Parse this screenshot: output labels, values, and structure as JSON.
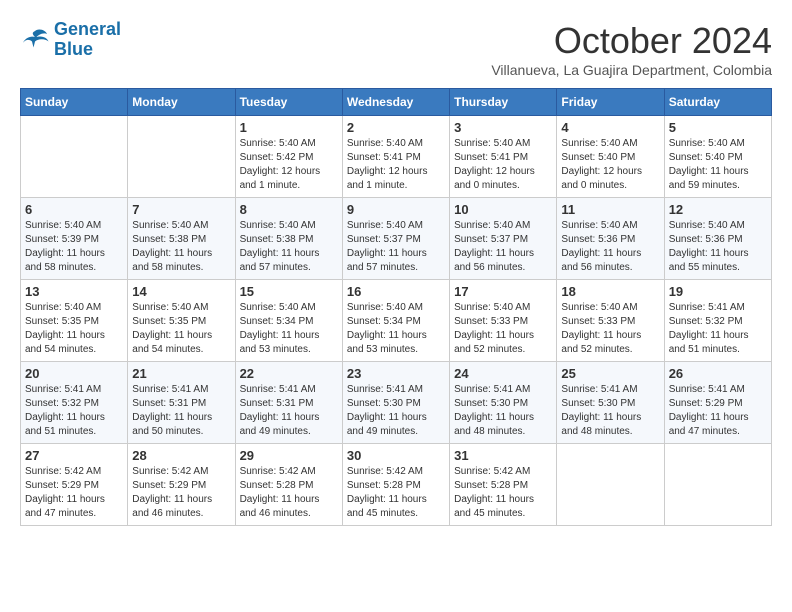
{
  "header": {
    "logo_line1": "General",
    "logo_line2": "Blue",
    "month_title": "October 2024",
    "location": "Villanueva, La Guajira Department, Colombia"
  },
  "days_of_week": [
    "Sunday",
    "Monday",
    "Tuesday",
    "Wednesday",
    "Thursday",
    "Friday",
    "Saturday"
  ],
  "weeks": [
    [
      {
        "day": "",
        "info": ""
      },
      {
        "day": "",
        "info": ""
      },
      {
        "day": "1",
        "info": "Sunrise: 5:40 AM\nSunset: 5:42 PM\nDaylight: 12 hours and 1 minute."
      },
      {
        "day": "2",
        "info": "Sunrise: 5:40 AM\nSunset: 5:41 PM\nDaylight: 12 hours and 1 minute."
      },
      {
        "day": "3",
        "info": "Sunrise: 5:40 AM\nSunset: 5:41 PM\nDaylight: 12 hours and 0 minutes."
      },
      {
        "day": "4",
        "info": "Sunrise: 5:40 AM\nSunset: 5:40 PM\nDaylight: 12 hours and 0 minutes."
      },
      {
        "day": "5",
        "info": "Sunrise: 5:40 AM\nSunset: 5:40 PM\nDaylight: 11 hours and 59 minutes."
      }
    ],
    [
      {
        "day": "6",
        "info": "Sunrise: 5:40 AM\nSunset: 5:39 PM\nDaylight: 11 hours and 58 minutes."
      },
      {
        "day": "7",
        "info": "Sunrise: 5:40 AM\nSunset: 5:38 PM\nDaylight: 11 hours and 58 minutes."
      },
      {
        "day": "8",
        "info": "Sunrise: 5:40 AM\nSunset: 5:38 PM\nDaylight: 11 hours and 57 minutes."
      },
      {
        "day": "9",
        "info": "Sunrise: 5:40 AM\nSunset: 5:37 PM\nDaylight: 11 hours and 57 minutes."
      },
      {
        "day": "10",
        "info": "Sunrise: 5:40 AM\nSunset: 5:37 PM\nDaylight: 11 hours and 56 minutes."
      },
      {
        "day": "11",
        "info": "Sunrise: 5:40 AM\nSunset: 5:36 PM\nDaylight: 11 hours and 56 minutes."
      },
      {
        "day": "12",
        "info": "Sunrise: 5:40 AM\nSunset: 5:36 PM\nDaylight: 11 hours and 55 minutes."
      }
    ],
    [
      {
        "day": "13",
        "info": "Sunrise: 5:40 AM\nSunset: 5:35 PM\nDaylight: 11 hours and 54 minutes."
      },
      {
        "day": "14",
        "info": "Sunrise: 5:40 AM\nSunset: 5:35 PM\nDaylight: 11 hours and 54 minutes."
      },
      {
        "day": "15",
        "info": "Sunrise: 5:40 AM\nSunset: 5:34 PM\nDaylight: 11 hours and 53 minutes."
      },
      {
        "day": "16",
        "info": "Sunrise: 5:40 AM\nSunset: 5:34 PM\nDaylight: 11 hours and 53 minutes."
      },
      {
        "day": "17",
        "info": "Sunrise: 5:40 AM\nSunset: 5:33 PM\nDaylight: 11 hours and 52 minutes."
      },
      {
        "day": "18",
        "info": "Sunrise: 5:40 AM\nSunset: 5:33 PM\nDaylight: 11 hours and 52 minutes."
      },
      {
        "day": "19",
        "info": "Sunrise: 5:41 AM\nSunset: 5:32 PM\nDaylight: 11 hours and 51 minutes."
      }
    ],
    [
      {
        "day": "20",
        "info": "Sunrise: 5:41 AM\nSunset: 5:32 PM\nDaylight: 11 hours and 51 minutes."
      },
      {
        "day": "21",
        "info": "Sunrise: 5:41 AM\nSunset: 5:31 PM\nDaylight: 11 hours and 50 minutes."
      },
      {
        "day": "22",
        "info": "Sunrise: 5:41 AM\nSunset: 5:31 PM\nDaylight: 11 hours and 49 minutes."
      },
      {
        "day": "23",
        "info": "Sunrise: 5:41 AM\nSunset: 5:30 PM\nDaylight: 11 hours and 49 minutes."
      },
      {
        "day": "24",
        "info": "Sunrise: 5:41 AM\nSunset: 5:30 PM\nDaylight: 11 hours and 48 minutes."
      },
      {
        "day": "25",
        "info": "Sunrise: 5:41 AM\nSunset: 5:30 PM\nDaylight: 11 hours and 48 minutes."
      },
      {
        "day": "26",
        "info": "Sunrise: 5:41 AM\nSunset: 5:29 PM\nDaylight: 11 hours and 47 minutes."
      }
    ],
    [
      {
        "day": "27",
        "info": "Sunrise: 5:42 AM\nSunset: 5:29 PM\nDaylight: 11 hours and 47 minutes."
      },
      {
        "day": "28",
        "info": "Sunrise: 5:42 AM\nSunset: 5:29 PM\nDaylight: 11 hours and 46 minutes."
      },
      {
        "day": "29",
        "info": "Sunrise: 5:42 AM\nSunset: 5:28 PM\nDaylight: 11 hours and 46 minutes."
      },
      {
        "day": "30",
        "info": "Sunrise: 5:42 AM\nSunset: 5:28 PM\nDaylight: 11 hours and 45 minutes."
      },
      {
        "day": "31",
        "info": "Sunrise: 5:42 AM\nSunset: 5:28 PM\nDaylight: 11 hours and 45 minutes."
      },
      {
        "day": "",
        "info": ""
      },
      {
        "day": "",
        "info": ""
      }
    ]
  ]
}
